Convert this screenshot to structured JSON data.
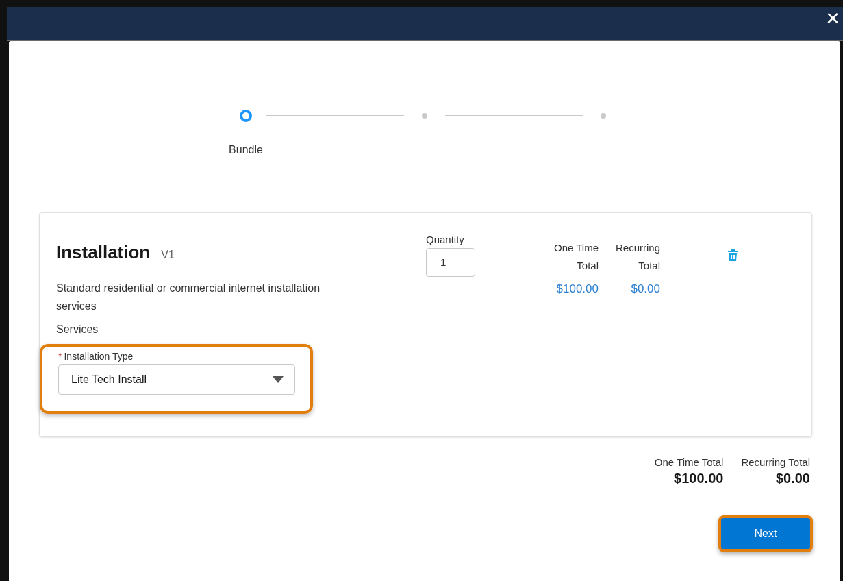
{
  "close_label": "✕",
  "steps": [
    {
      "label": "Bundle",
      "selected": true
    },
    {
      "selected": false
    },
    {
      "selected": false
    }
  ],
  "product": {
    "name": "Installation",
    "version": "V1",
    "description": "Standard residential or commercial internet installation services",
    "section": "Services",
    "quantity": {
      "label": "Quantity",
      "value": "1"
    },
    "one_time": {
      "label": "One Time Total",
      "amount": "$100.00"
    },
    "recurring": {
      "label": "Recurring Total",
      "amount": "$0.00"
    },
    "field": {
      "label": "Installation Type",
      "required_mark": "*",
      "value": "Lite Tech Install",
      "highlighted": true
    }
  },
  "totals": [
    {
      "label": "One Time Total",
      "amount": "$100.00"
    },
    {
      "label": "Recurring Total",
      "amount": "$0.00"
    }
  ],
  "next_button": {
    "label": "Next",
    "highlighted": true
  }
}
